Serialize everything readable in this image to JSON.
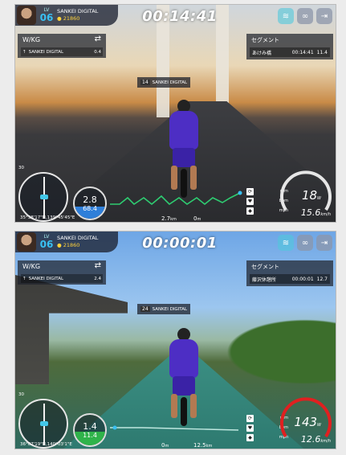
{
  "profile": {
    "level_label": "LV",
    "level": "06",
    "team": "SANKEI DIGITAL",
    "coins": "21860"
  },
  "wkg": {
    "title": "W/KG",
    "name": "SANKEI DIGITAL"
  },
  "segment": {
    "title": "セグメント"
  },
  "screens": [
    {
      "timer": "00:14:41",
      "wkg_value": "0.4",
      "segment_name": "あけみ橋",
      "segment_time": "00:14:41",
      "segment_dist": "11.4",
      "tag_num": "14",
      "tag_label": "SANKEI DIGITAL",
      "heading": "30",
      "coords": "35°38'17\"N,139°45'45\"E",
      "gauge_top": "2.8",
      "gauge_bottom": "68.4",
      "dist_a": "2.7",
      "dist_b": "0",
      "dist_unit_a": "km",
      "dist_unit_b": "m",
      "cadence_label": "rpm",
      "heart_label": "bpm",
      "power_label": "mph",
      "speed_big": "18",
      "speed_big_unit": "W",
      "speed_small": "15.6",
      "speed_small_unit": "km/h"
    },
    {
      "timer": "00:00:01",
      "wkg_value": "2.4",
      "segment_name": "藤沢休憩所",
      "segment_time": "00:00:01",
      "segment_dist": "12.7",
      "tag_num": "24",
      "tag_label": "SANKEI DIGITAL",
      "heading": "30",
      "coords": "36°07'19\"N,140°03'1\"E",
      "gauge_top": "1.4",
      "gauge_bottom": "11.4",
      "dist_a": "0",
      "dist_b": "12.5",
      "dist_unit_a": "m",
      "dist_unit_b": "km",
      "cadence_label": "rpm",
      "heart_label": "bpm",
      "power_label": "mph",
      "speed_big": "143",
      "speed_big_unit": "W",
      "speed_small": "12.6",
      "speed_small_unit": "km/h"
    }
  ],
  "colors": {
    "accent": "#39c0f2",
    "wkg_fill_1": "#2f7fd9",
    "wkg_fill_2": "#2fb34a",
    "speed_arc_1": "#e6e6e6",
    "speed_arc_2": "#e02020"
  }
}
